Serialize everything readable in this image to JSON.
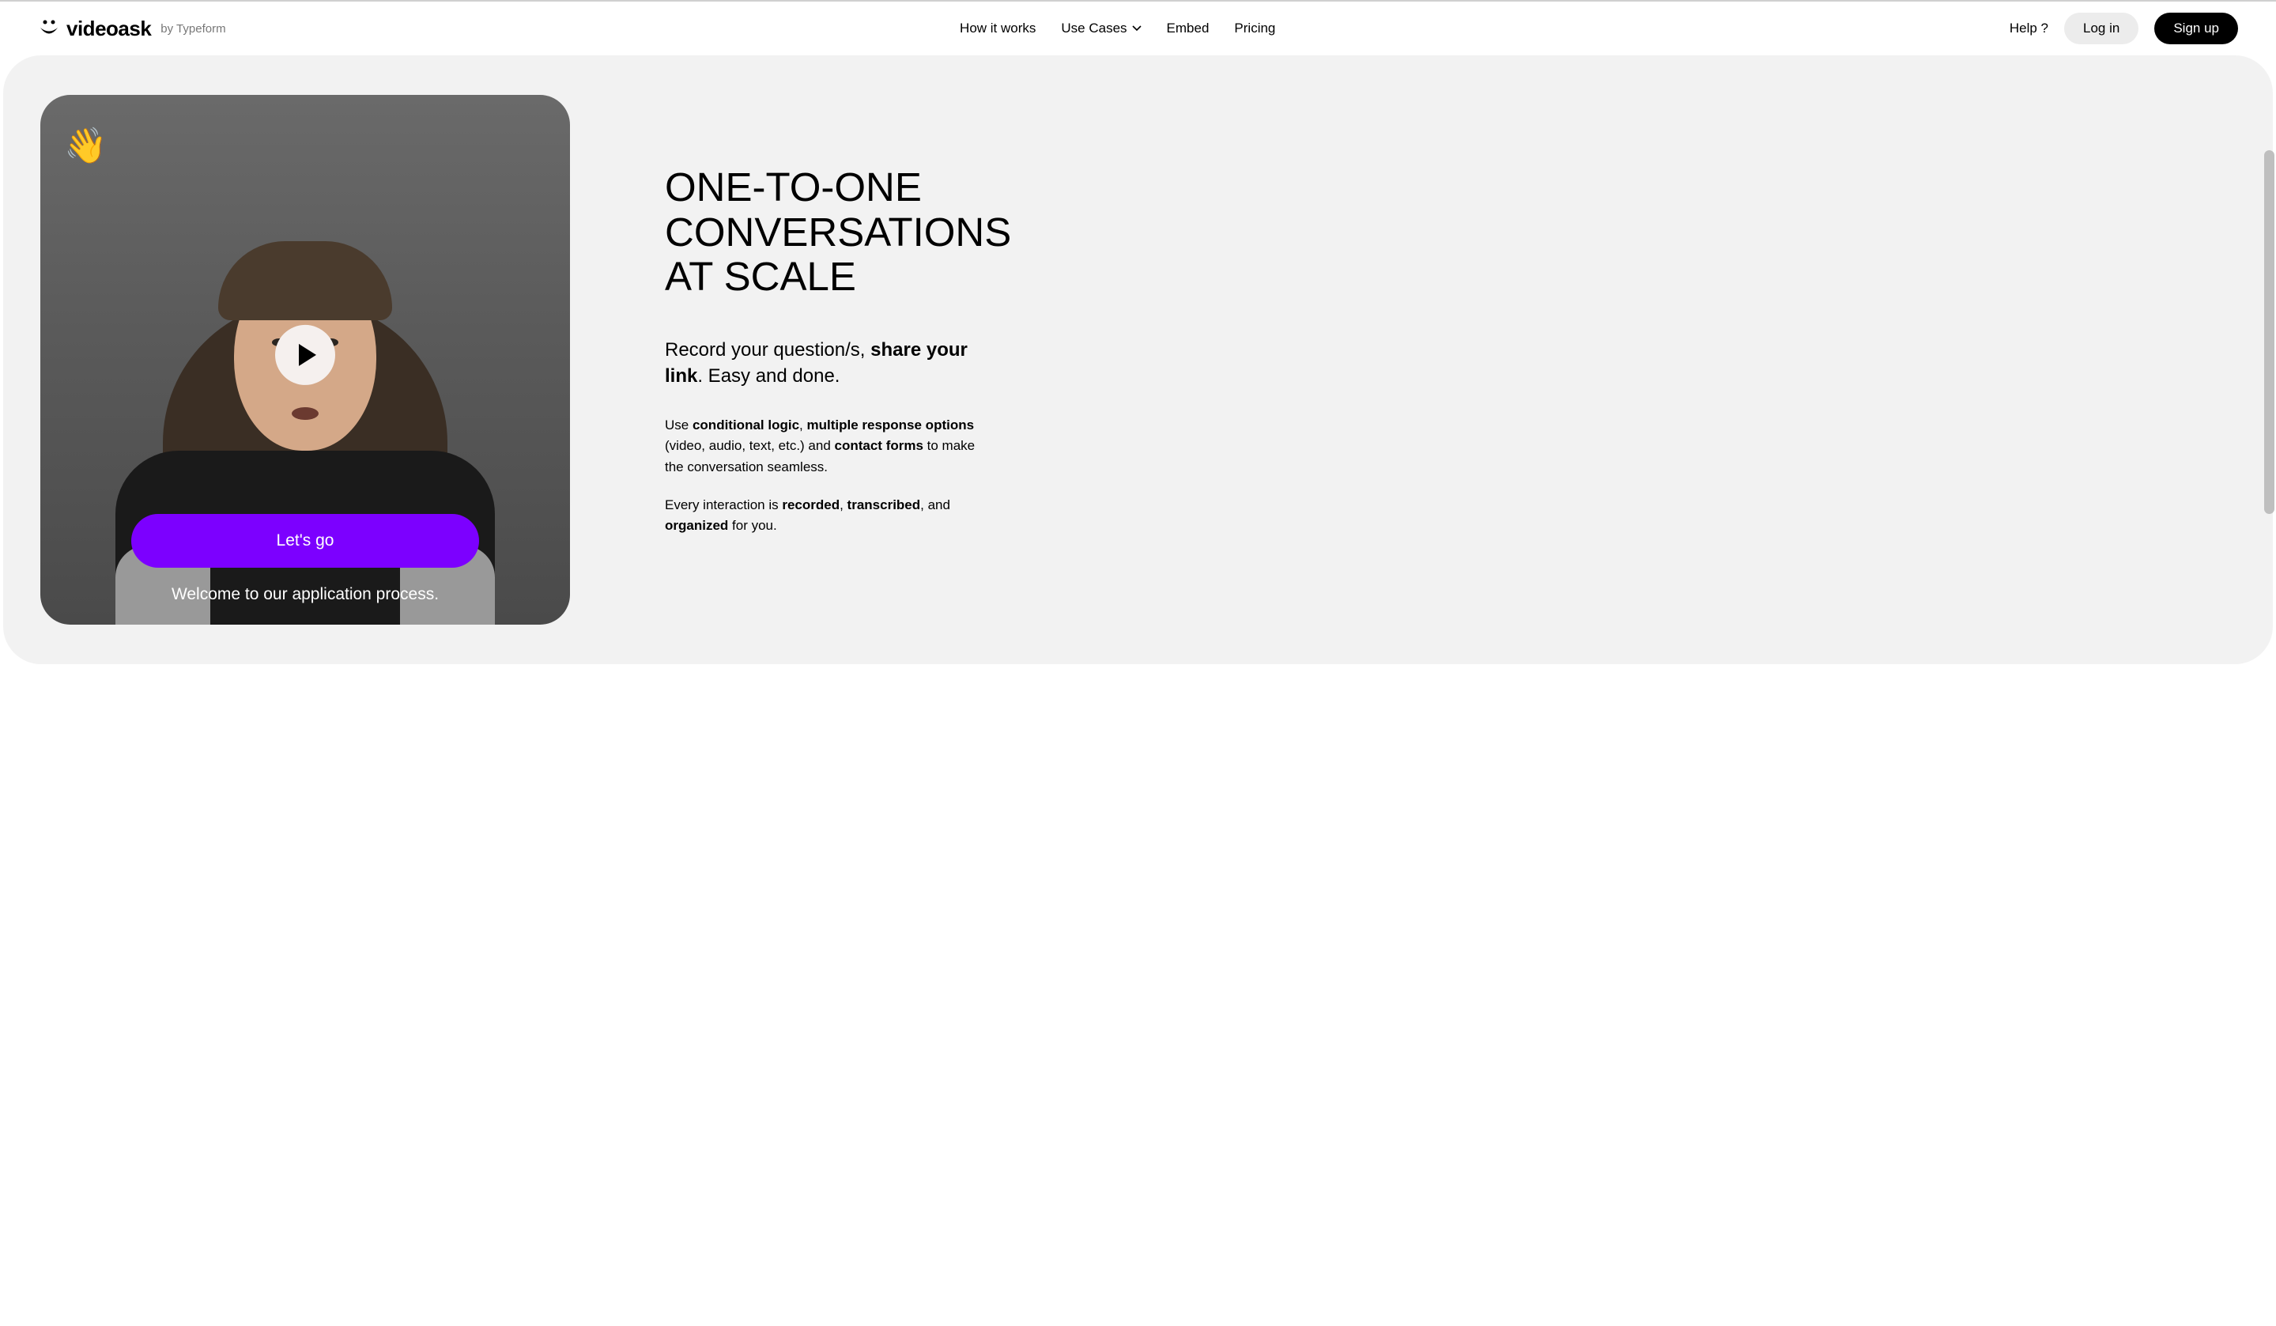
{
  "header": {
    "logo_text": "videoask",
    "byline_prefix": "by ",
    "byline_brand": "Typeform",
    "nav": {
      "how_it_works": "How it works",
      "use_cases": "Use Cases",
      "embed": "Embed",
      "pricing": "Pricing"
    },
    "help": "Help ?",
    "login": "Log in",
    "signup": "Sign up"
  },
  "hero": {
    "wave_emoji": "👋",
    "lets_go": "Let's go",
    "caption": "Welcome to our application process.",
    "title": "ONE-TO-ONE CONVERSATIONS AT SCALE",
    "subtitle_pre": "Record your question/s, ",
    "subtitle_bold": "share your link",
    "subtitle_post": ". Easy and done.",
    "body1_pre": "Use ",
    "body1_b1": "conditional logic",
    "body1_mid1": ", ",
    "body1_b2": "multiple response options",
    "body1_mid2": " (video, audio, text, etc.) and ",
    "body1_b3": "contact forms",
    "body1_post": " to make the conversation seamless.",
    "body2_pre": "Every interaction is ",
    "body2_b1": "recorded",
    "body2_mid1": ", ",
    "body2_b2": "transcribed",
    "body2_mid2": ", and ",
    "body2_b3": "organized",
    "body2_post": " for you."
  }
}
